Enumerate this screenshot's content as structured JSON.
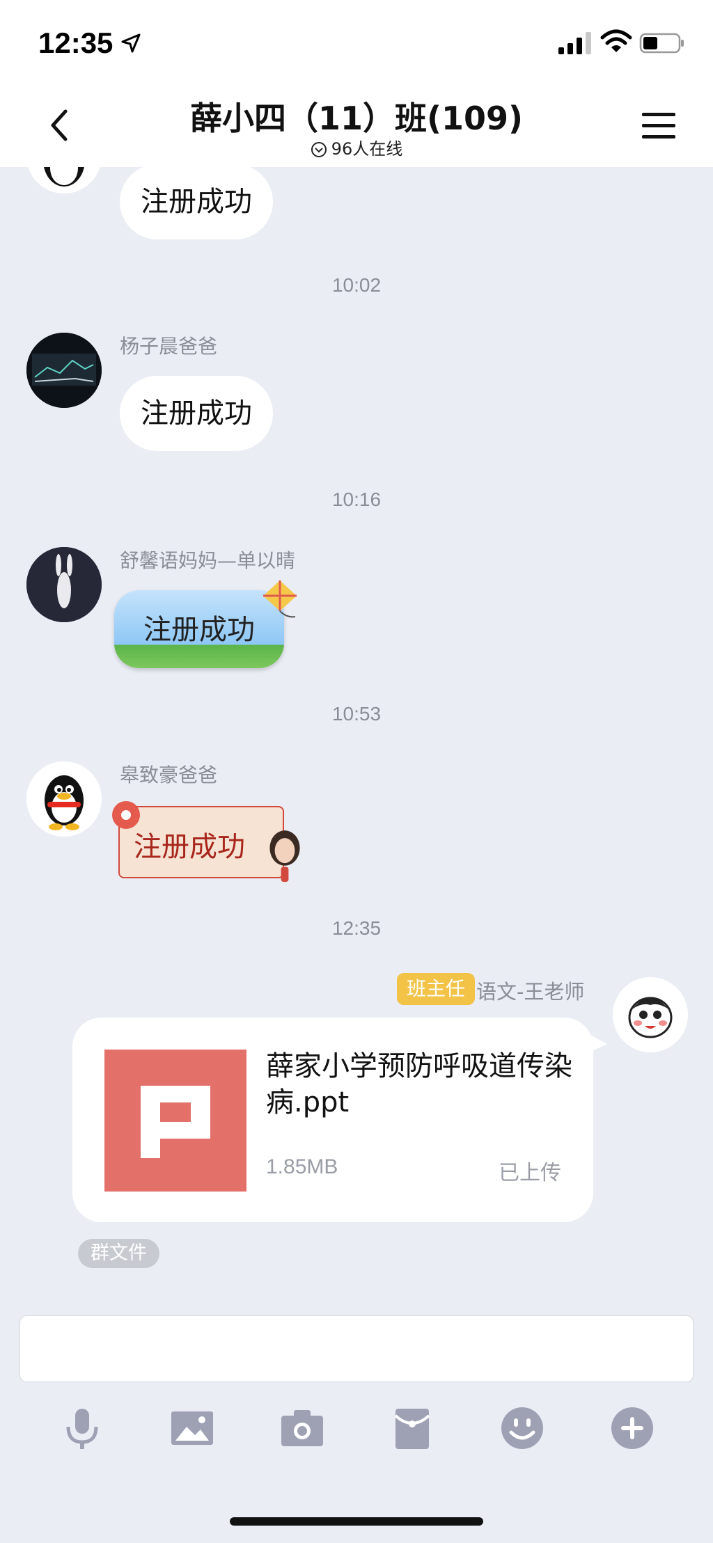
{
  "status_bar": {
    "time": "12:35"
  },
  "header": {
    "title": "薛小四（11）班(109)",
    "online": "96人在线"
  },
  "messages": [
    {
      "text": "注册成功"
    },
    {
      "time": "10:02",
      "sender": "杨子晨爸爸",
      "text": "注册成功"
    },
    {
      "time": "10:16",
      "sender": "舒馨语妈妈—单以晴",
      "text": "注册成功"
    },
    {
      "time": "10:53",
      "sender": "皋致豪爸爸",
      "text": "注册成功"
    }
  ],
  "file_message": {
    "time": "12:35",
    "role_badge": "班主任",
    "sender": "语文-王老师",
    "file_name": "薛家小学预防呼吸道传染病.ppt",
    "file_size": "1.85MB",
    "status": "已上传",
    "tag": "群文件"
  },
  "icons": [
    "back-icon",
    "menu-icon",
    "mic-icon",
    "image-icon",
    "camera-icon",
    "red-packet-icon",
    "emoji-icon",
    "plus-icon"
  ],
  "colors": {
    "background": "#ebedf5",
    "badge": "#f3c347",
    "ppt": "#e3716a",
    "toolbar_icon": "#9ea1b4"
  }
}
